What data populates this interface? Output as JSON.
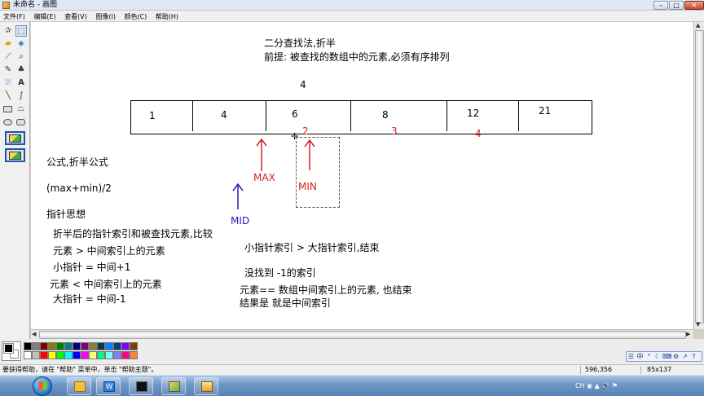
{
  "window": {
    "title": "未命名 - 画图",
    "minimize": "–",
    "maximize": "□",
    "close": "✕"
  },
  "menu": [
    "文件(F)",
    "编辑(E)",
    "查看(V)",
    "图像(I)",
    "颜色(C)",
    "帮助(H)"
  ],
  "tools": [
    "free-select",
    "rect-select",
    "eraser",
    "fill",
    "color-picker",
    "magnifier",
    "pencil",
    "brush",
    "airbrush",
    "text",
    "line",
    "curve",
    "rectangle",
    "polygon",
    "ellipse",
    "rounded-rectangle"
  ],
  "tool_glyphs": {
    "free-select": "✰",
    "rect-select": "⬚",
    "eraser": "▰",
    "fill": "◈",
    "color-picker": "⟋",
    "magnifier": "⌕",
    "pencil": "✎",
    "brush": "♣",
    "airbrush": "⛆",
    "text": "A",
    "line": "╲",
    "curve": "∫",
    "polygon": "⏢"
  },
  "canvas": {
    "heading": "二分查找法,折半",
    "premise": "前提: 被查找的数组中的元素,必须有序排列",
    "target_value": "4",
    "array_values": [
      "1",
      "4",
      "6",
      "8",
      "12",
      "21"
    ],
    "indices": [
      "2",
      "3",
      "4"
    ],
    "labels": {
      "max": "MAX",
      "min": "MIN",
      "mid": "MID"
    },
    "notes_left": [
      "公式,折半公式",
      "(max+min)/2",
      "指针思想",
      "折半后的指针索引和被查找元素,比较",
      "元素 >  中间索引上的元素",
      "小指针 = 中间+1",
      "元素 < 中间索引上的元素",
      "大指针 = 中间-1"
    ],
    "notes_right": [
      "小指针索引 > 大指针索引,结束",
      "没找到 -1的索引",
      "元素== 数组中间索引上的元素, 也结束",
      "结果是 就是中间索引"
    ]
  },
  "palette_colors": [
    "#000000",
    "#808080",
    "#800000",
    "#808000",
    "#008000",
    "#008080",
    "#000080",
    "#800080",
    "#808040",
    "#004040",
    "#0080ff",
    "#004080",
    "#8000ff",
    "#804000",
    "#ffffff",
    "#c0c0c0",
    "#ff0000",
    "#ffff00",
    "#00ff00",
    "#00ffff",
    "#0000ff",
    "#ff00ff",
    "#ffff80",
    "#00ff80",
    "#80ffff",
    "#8080ff",
    "#ff0080",
    "#ff8040"
  ],
  "colors": {
    "red_ink": "#d52020",
    "blue_ink": "#2020b8"
  },
  "ime": [
    "☰",
    "中",
    "°",
    "☾",
    "⌨",
    "⚙",
    "↗",
    "?",
    "▾"
  ],
  "status": {
    "help": "要获得帮助，请在 \"帮助\" 菜单中，单击 \"帮助主题\"。",
    "coords": "596,356",
    "size": "85x137"
  },
  "taskbar": {
    "tray": "CH ◉ ▲ 🔊 ⚑"
  }
}
